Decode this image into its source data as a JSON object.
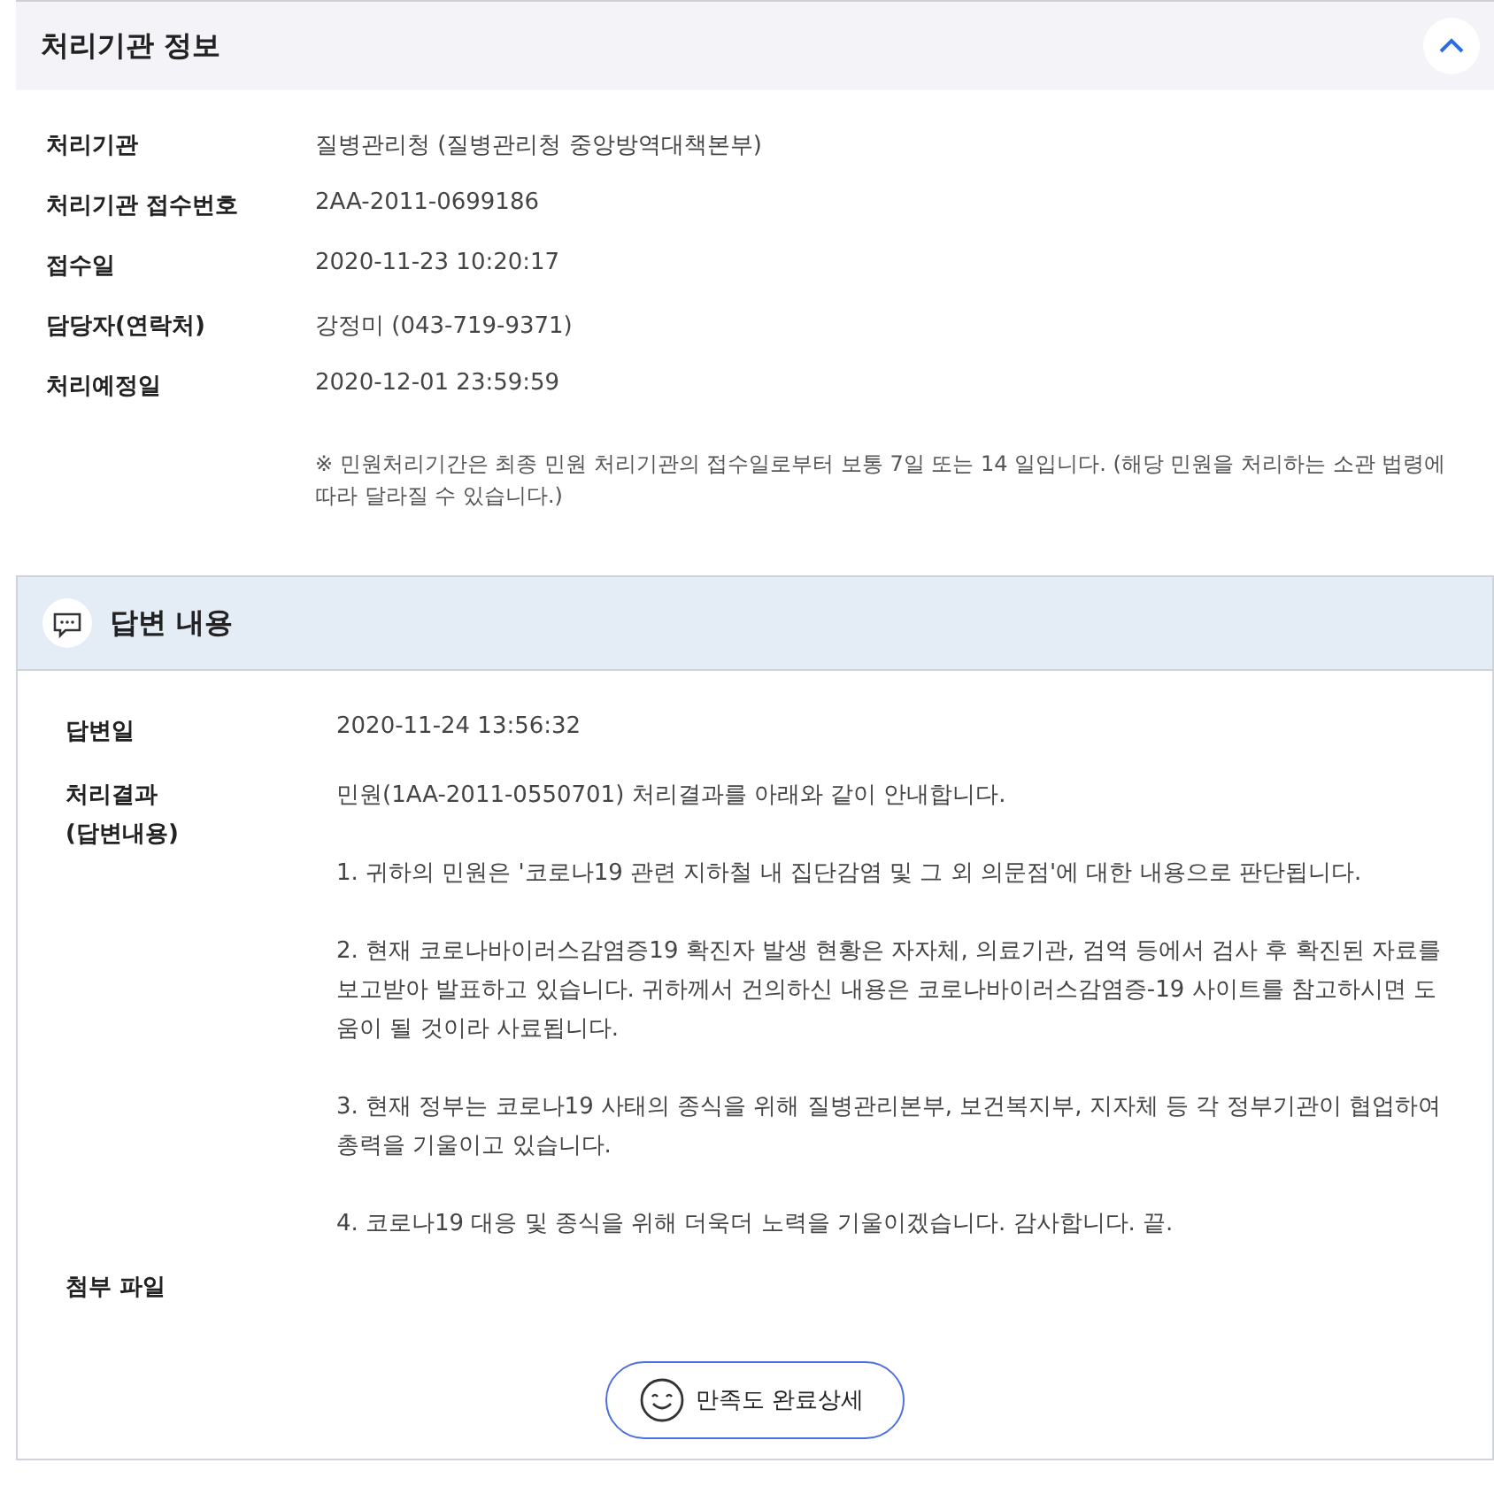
{
  "agency_section": {
    "title": "처리기관 정보",
    "expanded": true,
    "rows": [
      {
        "label": "처리기관",
        "value": "질병관리청 (질병관리청 중앙방역대책본부)"
      },
      {
        "label": "처리기관 접수번호",
        "value": "2AA-2011-0699186"
      },
      {
        "label": "접수일",
        "value": "2020-11-23 10:20:17"
      },
      {
        "label": "담당자(연락처)",
        "value": "강정미 (043-719-9371)"
      },
      {
        "label": "처리예정일",
        "value": "2020-12-01 23:59:59"
      }
    ],
    "note": "※ 민원처리기간은 최종 민원 처리기관의 접수일로부터 보통 7일 또는 14 일입니다. (해당 민원을 처리하는 소관 법령에 따라 달라질 수 있습니다.)"
  },
  "answer_section": {
    "title": "답변 내용",
    "answer_date_label": "답변일",
    "answer_date": "2020-11-24 13:56:32",
    "result_label": [
      "처리결과",
      "(답변내용)"
    ],
    "result_paragraphs": [
      "민원(1AA-2011-0550701) 처리결과를 아래와 같이 안내합니다.",
      "1. 귀하의 민원은 '코로나19 관련 지하철 내 집단감염 및 그 외 의문점'에 대한 내용으로 판단됩니다.",
      "2. 현재 코로나바이러스감염증19 확진자 발생 현황은 자자체, 의료기관, 검역 등에서 검사 후 확진된 자료를 보고받아 발표하고 있습니다. 귀하께서 건의하신 내용은 코로나바이러스감염증-19 사이트를 참고하시면 도움이 될 것이라 사료됩니다.",
      "3. 현재 정부는 코로나19 사태의 종식을 위해 질병관리본부, 보건복지부, 지자체 등 각 정부기관이 협업하여 총력을 기울이고 있습니다.",
      "4. 코로나19 대응 및 종식을 위해 더욱더 노력을 기울이겠습니다. 감사합니다. 끝."
    ],
    "attachment_label": "첨부 파일",
    "satisfaction_button": "만족도 완료상세"
  }
}
